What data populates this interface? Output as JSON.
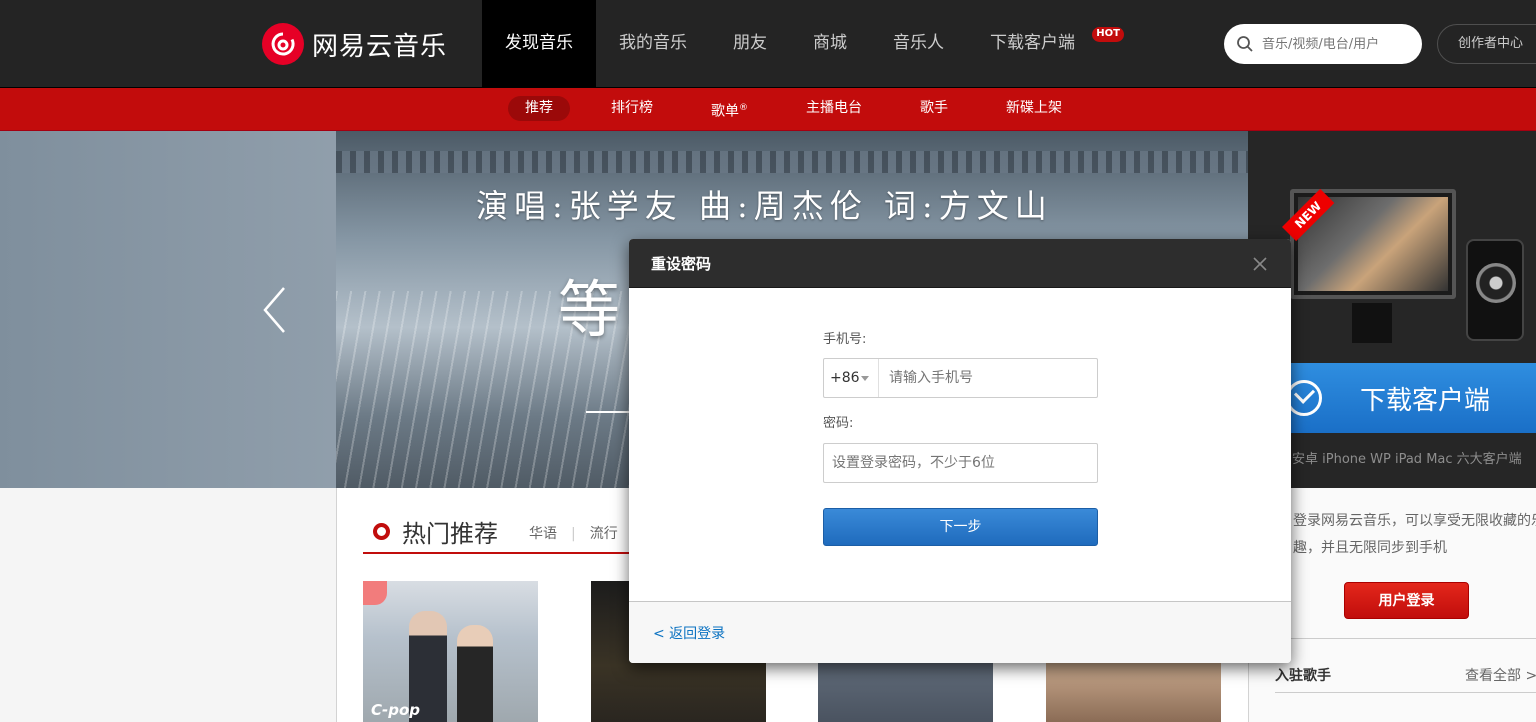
{
  "header": {
    "logo_text": "网易云音乐",
    "nav": [
      {
        "label": "发现音乐",
        "active": true
      },
      {
        "label": "我的音乐",
        "active": false
      },
      {
        "label": "朋友",
        "active": false
      },
      {
        "label": "商城",
        "active": false
      },
      {
        "label": "音乐人",
        "active": false
      },
      {
        "label": "下载客户端",
        "active": false
      }
    ],
    "hot_badge": "HOT",
    "search_placeholder": "音乐/视频/电台/用户",
    "creator_button": "创作者中心"
  },
  "subnav": {
    "items": [
      "推荐",
      "排行榜",
      "歌单",
      "主播电台",
      "歌手",
      "新碟上架"
    ],
    "registered_mark": "®"
  },
  "banner": {
    "credit": "演唱:张学友  曲:周杰伦  词:方文山",
    "title": "等"
  },
  "download_ad": {
    "new_badge": "NEW",
    "button": "下载客户端",
    "platforms": "安卓 iPhone WP iPad Mac 六大客户端"
  },
  "hot": {
    "title": "热门推荐",
    "tags": [
      "华语",
      "流行"
    ],
    "cover1_label": "C-pop"
  },
  "side": {
    "text": "登录网易云音乐，可以享受无限收藏的乐趣，并且无限同步到手机",
    "login_button": "用户登录",
    "singers_title": "入驻歌手",
    "view_all": "查看全部 >"
  },
  "modal": {
    "title": "重设密码",
    "phone_label": "手机号:",
    "country_code": "+86",
    "phone_placeholder": "请输入手机号",
    "password_label": "密码:",
    "password_placeholder": "设置登录密码，不少于6位",
    "next_button": "下一步",
    "back_link": "<  返回登录"
  },
  "colors": {
    "brand_red": "#c20c0c",
    "dark_header": "#242424",
    "link_blue": "#0c73c2"
  }
}
